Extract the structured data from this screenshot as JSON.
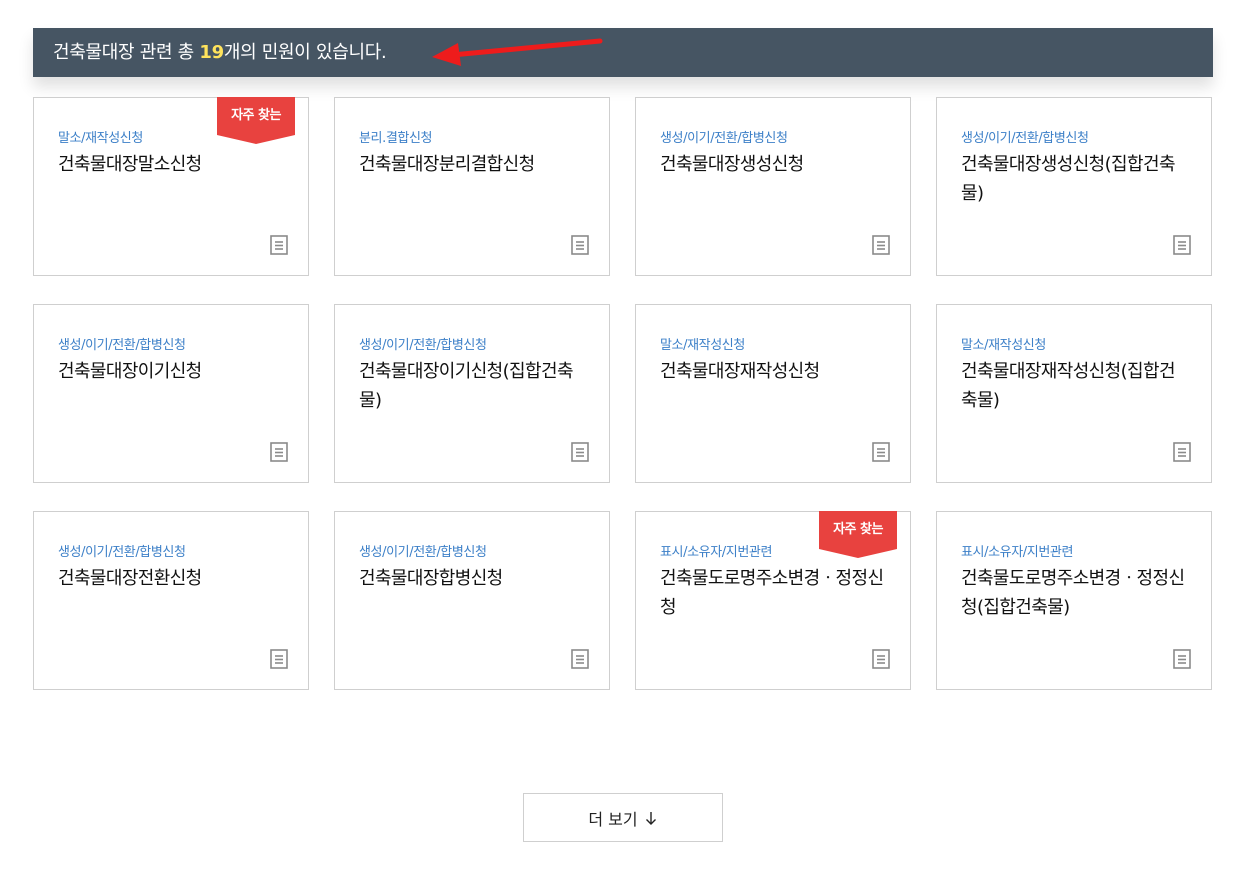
{
  "summary": {
    "prefix": "건축물대장 관련 총 ",
    "count": "19",
    "suffix": "개의 민원이 있습니다."
  },
  "badge_label": "자주 찾는",
  "cards": [
    {
      "category": "말소/재작성신청",
      "title": "건축물대장말소신청",
      "frequent": true
    },
    {
      "category": "분리.결합신청",
      "title": "건축물대장분리결합신청",
      "frequent": false
    },
    {
      "category": "생성/이기/전환/합병신청",
      "title": "건축물대장생성신청",
      "frequent": false
    },
    {
      "category": "생성/이기/전환/합병신청",
      "title": "건축물대장생성신청(집합건축물)",
      "frequent": false
    },
    {
      "category": "생성/이기/전환/합병신청",
      "title": "건축물대장이기신청",
      "frequent": false
    },
    {
      "category": "생성/이기/전환/합병신청",
      "title": "건축물대장이기신청(집합건축물)",
      "frequent": false
    },
    {
      "category": "말소/재작성신청",
      "title": "건축물대장재작성신청",
      "frequent": false
    },
    {
      "category": "말소/재작성신청",
      "title": "건축물대장재작성신청(집합건축물)",
      "frequent": false
    },
    {
      "category": "생성/이기/전환/합병신청",
      "title": "건축물대장전환신청",
      "frequent": false
    },
    {
      "category": "생성/이기/전환/합병신청",
      "title": "건축물대장합병신청",
      "frequent": false
    },
    {
      "category": "표시/소유자/지번관련",
      "title": "건축물도로명주소변경ㆍ정정신청",
      "frequent": true
    },
    {
      "category": "표시/소유자/지번관련",
      "title": "건축물도로명주소변경ㆍ정정신청(집합건축물)",
      "frequent": false
    }
  ],
  "more_button": {
    "label": "더 보기"
  },
  "colors": {
    "bar": "#465563",
    "count": "#ffe35c",
    "category": "#3d80c8",
    "badge": "#e8423f",
    "arrow": "#ee1c1c"
  },
  "icons": {
    "card": "document-icon",
    "more": "arrow-down-icon",
    "annotation": "red-arrow-icon"
  }
}
